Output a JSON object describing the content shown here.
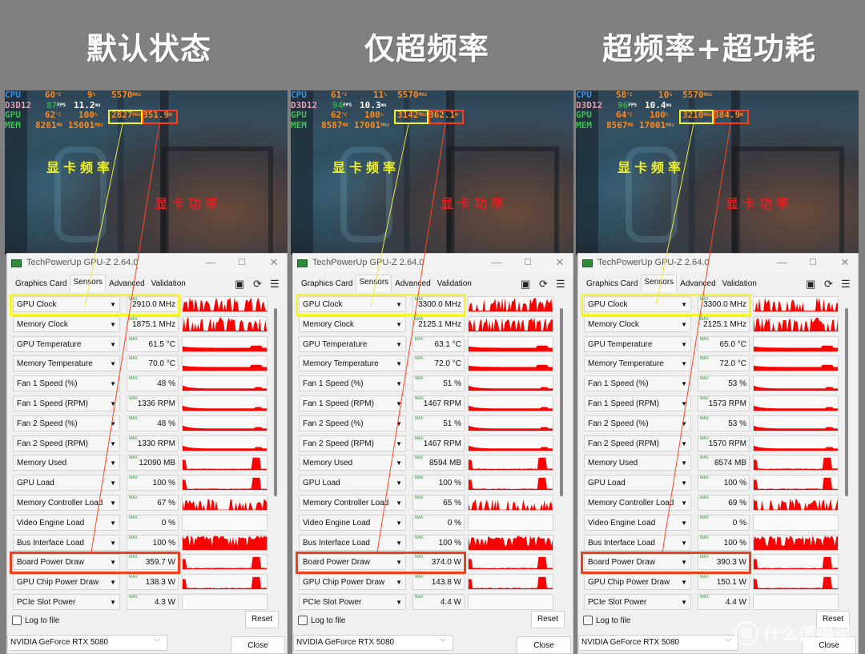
{
  "headings": [
    "默认状态",
    "仅超频率",
    "超频率+超功耗"
  ],
  "annotations": {
    "clock_label": "显卡频率",
    "power_label": "显卡功率"
  },
  "colors": {
    "graph_fill": "#ff0000",
    "highlight_clock": "#f5f52a",
    "highlight_power": "#f0401a",
    "background": "#808080"
  },
  "panels": [
    {
      "osd": {
        "cpu": {
          "label": "CPU",
          "temp": "60",
          "temp_unit": "°C",
          "load": "9",
          "load_unit": "%",
          "clock": "5570",
          "clock_unit": "MHz"
        },
        "d3d": {
          "label": "D3D12",
          "fps": "87",
          "fps_unit": "FPS",
          "frametime": "11.2",
          "frametime_unit": "ms"
        },
        "gpu": {
          "label": "GPU",
          "temp": "62",
          "temp_unit": "°C",
          "load": "100",
          "load_unit": "%",
          "clock": "2827",
          "clock_unit": "MHz",
          "power": "351.9",
          "power_unit": "W"
        },
        "mem": {
          "label": "MEM",
          "used": "8281",
          "used_unit": "MB",
          "clock": "15001",
          "clock_unit": "MHz"
        }
      },
      "window": {
        "title": "TechPowerUp GPU-Z 2.64.0",
        "tabs": [
          "Graphics Card",
          "Sensors",
          "Advanced",
          "Validation"
        ],
        "active_tab": "Sensors",
        "max_label": "MAX",
        "sensors": [
          {
            "name": "GPU Clock",
            "value": "2910.0 MHz"
          },
          {
            "name": "Memory Clock",
            "value": "1875.1 MHz"
          },
          {
            "name": "GPU Temperature",
            "value": "61.5 °C"
          },
          {
            "name": "Memory Temperature",
            "value": "70.0 °C"
          },
          {
            "name": "Fan 1 Speed (%)",
            "value": "48 %"
          },
          {
            "name": "Fan 1 Speed (RPM)",
            "value": "1336 RPM"
          },
          {
            "name": "Fan 2 Speed (%)",
            "value": "48 %"
          },
          {
            "name": "Fan 2 Speed (RPM)",
            "value": "1330 RPM"
          },
          {
            "name": "Memory Used",
            "value": "12090 MB"
          },
          {
            "name": "GPU Load",
            "value": "100 %"
          },
          {
            "name": "Memory Controller Load",
            "value": "67 %"
          },
          {
            "name": "Video Engine Load",
            "value": "0 %"
          },
          {
            "name": "Bus Interface Load",
            "value": "100 %"
          },
          {
            "name": "Board Power Draw",
            "value": "359.7 W"
          },
          {
            "name": "GPU Chip Power Draw",
            "value": "138.3 W"
          },
          {
            "name": "PCIe Slot Power",
            "value": "4.3 W"
          }
        ],
        "log_to_file": "Log to file",
        "log_checked": false,
        "reset": "Reset",
        "device": "NVIDIA GeForce RTX 5080",
        "close": "Close"
      }
    },
    {
      "osd": {
        "cpu": {
          "label": "CPU",
          "temp": "61",
          "temp_unit": "°C",
          "load": "11",
          "load_unit": "%",
          "clock": "5570",
          "clock_unit": "MHz"
        },
        "d3d": {
          "label": "D3D12",
          "fps": "94",
          "fps_unit": "FPS",
          "frametime": "10.3",
          "frametime_unit": "ms"
        },
        "gpu": {
          "label": "GPU",
          "temp": "62",
          "temp_unit": "°C",
          "load": "100",
          "load_unit": "%",
          "clock": "3142",
          "clock_unit": "MHz",
          "power": "362.1",
          "power_unit": "W"
        },
        "mem": {
          "label": "MEM",
          "used": "8587",
          "used_unit": "MB",
          "clock": "17001",
          "clock_unit": "MHz"
        }
      },
      "window": {
        "title": "TechPowerUp GPU-Z 2.64.0",
        "tabs": [
          "Graphics Card",
          "Sensors",
          "Advanced",
          "Validation"
        ],
        "active_tab": "Sensors",
        "max_label": "MAX",
        "sensors": [
          {
            "name": "GPU Clock",
            "value": "3300.0 MHz"
          },
          {
            "name": "Memory Clock",
            "value": "2125.1 MHz"
          },
          {
            "name": "GPU Temperature",
            "value": "63.1 °C"
          },
          {
            "name": "Memory Temperature",
            "value": "72.0 °C"
          },
          {
            "name": "Fan 1 Speed (%)",
            "value": "51 %"
          },
          {
            "name": "Fan 1 Speed (RPM)",
            "value": "1467 RPM"
          },
          {
            "name": "Fan 2 Speed (%)",
            "value": "51 %"
          },
          {
            "name": "Fan 2 Speed (RPM)",
            "value": "1467 RPM"
          },
          {
            "name": "Memory Used",
            "value": "8594 MB"
          },
          {
            "name": "GPU Load",
            "value": "100 %"
          },
          {
            "name": "Memory Controller Load",
            "value": "65 %"
          },
          {
            "name": "Video Engine Load",
            "value": "0 %"
          },
          {
            "name": "Bus Interface Load",
            "value": "100 %"
          },
          {
            "name": "Board Power Draw",
            "value": "374.0 W"
          },
          {
            "name": "GPU Chip Power Draw",
            "value": "143.8 W"
          },
          {
            "name": "PCIe Slot Power",
            "value": "4.4 W"
          }
        ],
        "log_to_file": "Log to file",
        "log_checked": false,
        "reset": "Reset",
        "device": "NVIDIA GeForce RTX 5080",
        "close": "Close"
      }
    },
    {
      "osd": {
        "cpu": {
          "label": "CPU",
          "temp": "58",
          "temp_unit": "°C",
          "load": "10",
          "load_unit": "%",
          "clock": "5570",
          "clock_unit": "MHz"
        },
        "d3d": {
          "label": "D3D12",
          "fps": "96",
          "fps_unit": "FPS",
          "frametime": "10.4",
          "frametime_unit": "ms"
        },
        "gpu": {
          "label": "GPU",
          "temp": "64",
          "temp_unit": "°C",
          "load": "100",
          "load_unit": "%",
          "clock": "3210",
          "clock_unit": "MHz",
          "power": "384.9",
          "power_unit": "W"
        },
        "mem": {
          "label": "MEM",
          "used": "8567",
          "used_unit": "MB",
          "clock": "17001",
          "clock_unit": "MHz"
        }
      },
      "window": {
        "title": "TechPowerUp GPU-Z 2.64.0",
        "tabs": [
          "Graphics Card",
          "Sensors",
          "Advanced",
          "Validation"
        ],
        "active_tab": "Sensors",
        "max_label": "MAX",
        "sensors": [
          {
            "name": "GPU Clock",
            "value": "3300.0 MHz"
          },
          {
            "name": "Memory Clock",
            "value": "2125.1 MHz"
          },
          {
            "name": "GPU Temperature",
            "value": "65.0 °C"
          },
          {
            "name": "Memory Temperature",
            "value": "72.0 °C"
          },
          {
            "name": "Fan 1 Speed (%)",
            "value": "53 %"
          },
          {
            "name": "Fan 1 Speed (RPM)",
            "value": "1573 RPM"
          },
          {
            "name": "Fan 2 Speed (%)",
            "value": "53 %"
          },
          {
            "name": "Fan 2 Speed (RPM)",
            "value": "1570 RPM"
          },
          {
            "name": "Memory Used",
            "value": "8574 MB"
          },
          {
            "name": "GPU Load",
            "value": "100 %"
          },
          {
            "name": "Memory Controller Load",
            "value": "69 %"
          },
          {
            "name": "Video Engine Load",
            "value": "0 %"
          },
          {
            "name": "Bus Interface Load",
            "value": "100 %"
          },
          {
            "name": "Board Power Draw",
            "value": "390.3 W"
          },
          {
            "name": "GPU Chip Power Draw",
            "value": "150.1 W"
          },
          {
            "name": "PCIe Slot Power",
            "value": "4.4 W"
          }
        ],
        "log_to_file": "Log to file",
        "log_checked": false,
        "reset": "Reset",
        "device": "NVIDIA GeForce RTX 5080",
        "close": "Close"
      }
    }
  ],
  "watermark": {
    "logo": "值",
    "text": "什么值得买"
  }
}
